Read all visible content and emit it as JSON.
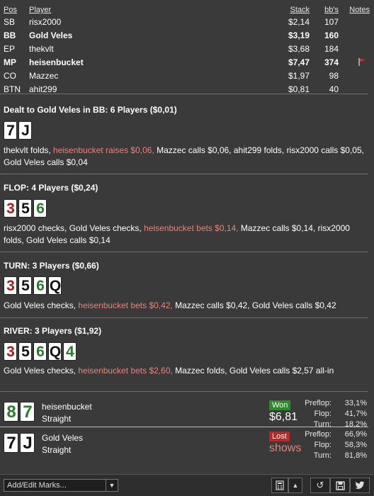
{
  "header": {
    "pos": "Pos",
    "player": "Player",
    "stack": "Stack",
    "bbs": "bb's",
    "notes": "Notes"
  },
  "players": [
    {
      "pos": "SB",
      "name": "risx2000",
      "stack": "$2,14",
      "bbs": "107",
      "bold": false,
      "flag": false
    },
    {
      "pos": "BB",
      "name": "Gold Veles",
      "stack": "$3,19",
      "bbs": "160",
      "bold": true,
      "flag": false
    },
    {
      "pos": "EP",
      "name": "thekvlt",
      "stack": "$3,68",
      "bbs": "184",
      "bold": false,
      "flag": false
    },
    {
      "pos": "MP",
      "name": "heisenbucket",
      "stack": "$7,47",
      "bbs": "374",
      "bold": true,
      "flag": true
    },
    {
      "pos": "CO",
      "name": "Mazzec",
      "stack": "$1,97",
      "bbs": "98",
      "bold": false,
      "flag": false
    },
    {
      "pos": "BTN",
      "name": "ahit299",
      "stack": "$0,81",
      "bbs": "40",
      "bold": false,
      "flag": false
    }
  ],
  "preflop": {
    "title": "Dealt to Gold Veles in BB: 6 Players ($0,01)",
    "cards": [
      {
        "r": "7",
        "c": "black"
      },
      {
        "r": "J",
        "c": "black"
      }
    ],
    "a1": "thekvlt folds, ",
    "a2": "heisenbucket raises $0,06,",
    "a3": " Mazzec calls $0,06, ahit299 folds, risx2000 calls $0,05, Gold Veles calls $0,04"
  },
  "flop": {
    "title": "FLOP: 4 Players ($0,24)",
    "cards": [
      {
        "r": "3",
        "c": "red"
      },
      {
        "r": "5",
        "c": "black"
      },
      {
        "r": "6",
        "c": "green"
      }
    ],
    "a1": "risx2000 checks, Gold Veles checks, ",
    "a2": "heisenbucket bets $0,14,",
    "a3": " Mazzec calls $0,14, risx2000 folds, Gold Veles calls $0,14"
  },
  "turn": {
    "title": "TURN: 3 Players ($0,66)",
    "cards": [
      {
        "r": "3",
        "c": "red"
      },
      {
        "r": "5",
        "c": "black"
      },
      {
        "r": "6",
        "c": "green"
      },
      {
        "r": "Q",
        "c": "black"
      }
    ],
    "a1": "Gold Veles checks, ",
    "a2": "heisenbucket bets $0,42,",
    "a3": " Mazzec calls $0,42, Gold Veles calls $0,42"
  },
  "river": {
    "title": "RIVER: 3 Players ($1,92)",
    "cards": [
      {
        "r": "3",
        "c": "red"
      },
      {
        "r": "5",
        "c": "black"
      },
      {
        "r": "6",
        "c": "green"
      },
      {
        "r": "Q",
        "c": "black"
      },
      {
        "r": "4",
        "c": "green"
      }
    ],
    "a1": "Gold Veles checks, ",
    "a2": "heisenbucket bets $2,60,",
    "a3": " Mazzec folds, Gold Veles calls $2,57 all-in"
  },
  "showdown": [
    {
      "cards": [
        {
          "r": "8",
          "c": "green"
        },
        {
          "r": "7",
          "c": "green"
        }
      ],
      "name": "heisenbucket",
      "hand": "Straight",
      "result": "Won",
      "amount": "$6,81",
      "stats": [
        {
          "l": "Preflop:",
          "v": "33,1%"
        },
        {
          "l": "Flop:",
          "v": "41,7%"
        },
        {
          "l": "Turn:",
          "v": "18,2%"
        }
      ]
    },
    {
      "cards": [
        {
          "r": "7",
          "c": "black"
        },
        {
          "r": "J",
          "c": "black"
        }
      ],
      "name": "Gold Veles",
      "hand": "Straight",
      "result": "Lost",
      "amount": "shows",
      "stats": [
        {
          "l": "Preflop:",
          "v": "66,9%"
        },
        {
          "l": "Flop:",
          "v": "58,3%"
        },
        {
          "l": "Turn:",
          "v": "81,8%"
        }
      ]
    }
  ],
  "bottombar": {
    "marks_label": "Add/Edit Marks...",
    "icons": [
      "calculator-icon",
      "updown-icon",
      "refresh-icon",
      "save-icon",
      "twitter-icon"
    ]
  }
}
